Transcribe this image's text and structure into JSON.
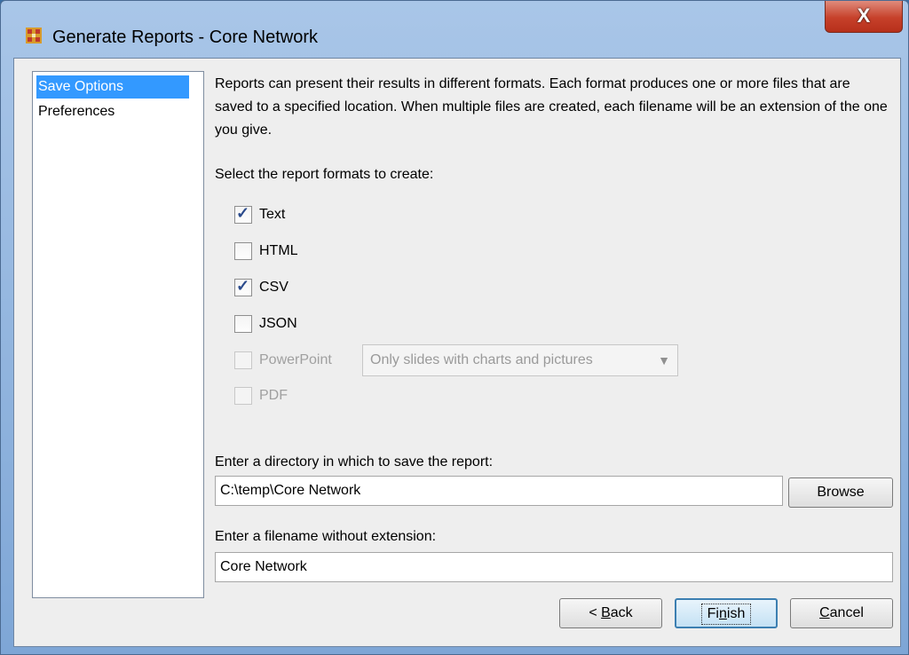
{
  "window": {
    "title": "Generate Reports - Core Network",
    "close_label": "X"
  },
  "sidebar": {
    "items": [
      {
        "label": "Save Options",
        "selected": true
      },
      {
        "label": "Preferences",
        "selected": false
      }
    ]
  },
  "main": {
    "intro": "Reports can present their results in different formats. Each format produces one or more files that are saved to a specified location. When multiple files are created, each filename will be an extension of the one you give.",
    "formats_label": "Select the report formats to create:",
    "formats": [
      {
        "label": "Text",
        "checked": true,
        "enabled": true
      },
      {
        "label": "HTML",
        "checked": false,
        "enabled": true
      },
      {
        "label": "CSV",
        "checked": true,
        "enabled": true
      },
      {
        "label": "JSON",
        "checked": false,
        "enabled": true
      },
      {
        "label": "PowerPoint",
        "checked": false,
        "enabled": false
      },
      {
        "label": "PDF",
        "checked": false,
        "enabled": false
      }
    ],
    "powerpoint_option": "Only slides with charts and pictures",
    "directory_label": "Enter a directory in which to save the report:",
    "directory_value": "C:\\temp\\Core Network",
    "browse_label": "Browse",
    "filename_label": "Enter a filename without extension:",
    "filename_value": "Core Network"
  },
  "footer": {
    "back_prefix": "< ",
    "back_mnemonic": "B",
    "back_rest": "ack",
    "finish_start": "Fi",
    "finish_mnemonic": "n",
    "finish_rest": "ish",
    "cancel_mnemonic": "C",
    "cancel_rest": "ancel"
  },
  "colors": {
    "selection": "#3399ff",
    "close_button": "#c6402a",
    "default_button_border": "#3c7fb1"
  }
}
